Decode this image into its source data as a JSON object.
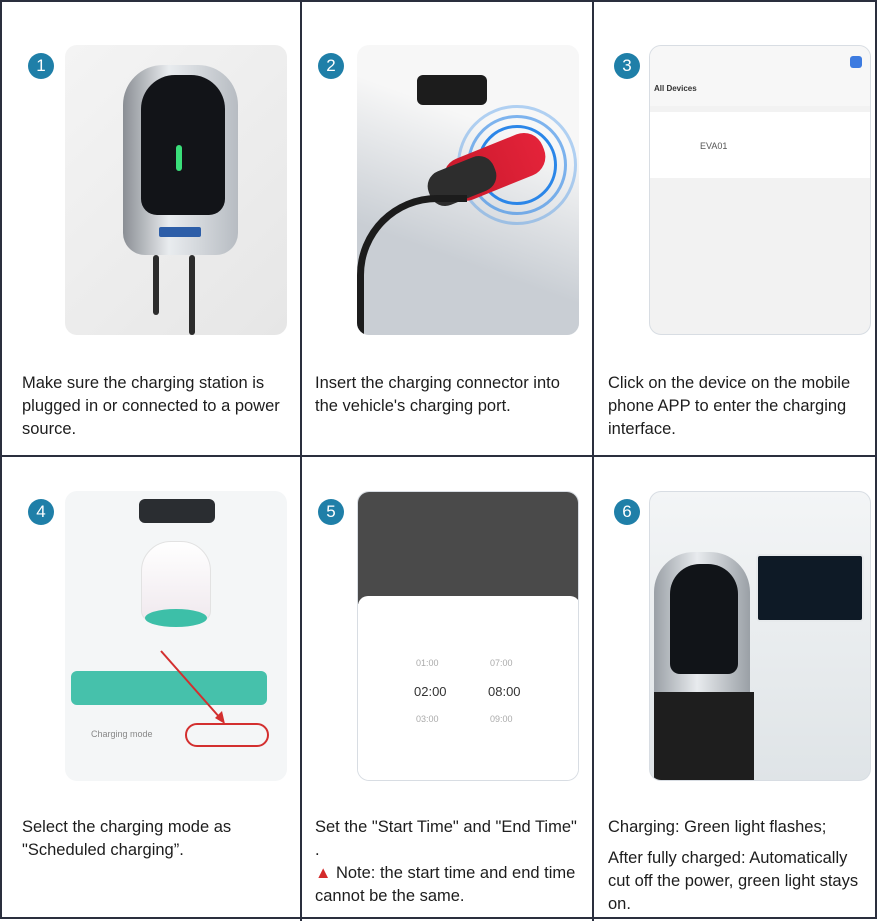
{
  "steps": [
    {
      "number": "1",
      "caption": "Make sure the charging station is plugged in or connected to a power source."
    },
    {
      "number": "2",
      "caption": "Insert the charging connector into the vehicle's charging port."
    },
    {
      "number": "3",
      "caption": "Click on the device on the mobile phone APP to enter the charging interface.",
      "screen": {
        "title": "All Devices",
        "device": "EVA01"
      }
    },
    {
      "number": "4",
      "caption": "Select the charging mode as \"Scheduled charging”.",
      "screen": {
        "mode_label": "Charging mode"
      }
    },
    {
      "number": "5",
      "caption": "Set the \"Start Time\" and \"End Time\" .",
      "note": "Note: the start time and end time cannot be the same.",
      "screen": {
        "start_time": "02:00",
        "end_time": "08:00",
        "start_prev": "01:00",
        "end_prev": "07:00",
        "start_next": "03:00",
        "end_next": "09:00"
      }
    },
    {
      "number": "6",
      "caption_1": "Charging: Green light flashes;",
      "caption_2": "After fully charged: Automatically cut off the power, green light stays on."
    }
  ],
  "colors": {
    "badge": "#1f7fa8",
    "grid_line": "#2a2f3e",
    "warning": "#d42b2b",
    "app_accent": "#46c1ab",
    "highlight": "#d32f2f"
  },
  "icons": {
    "warning": "warning-triangle-icon"
  }
}
